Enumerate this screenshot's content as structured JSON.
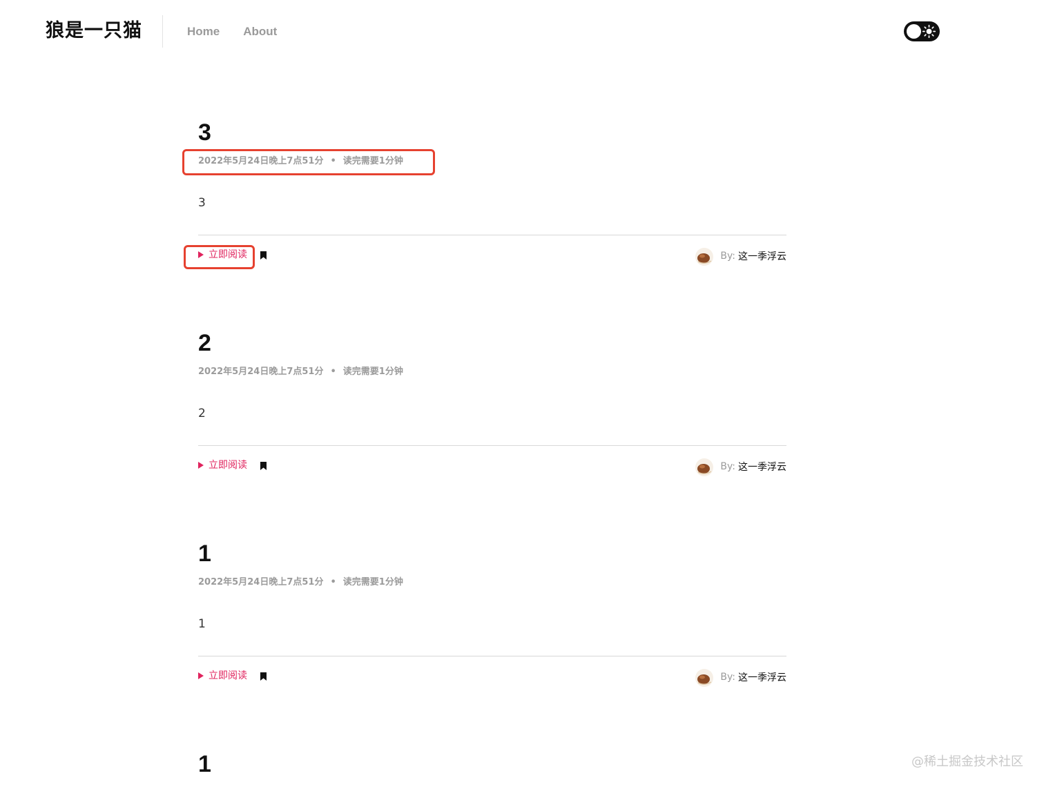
{
  "header": {
    "site_title": "狼是一只猫",
    "nav": [
      {
        "label": "Home"
      },
      {
        "label": "About"
      }
    ]
  },
  "posts": [
    {
      "title": "3",
      "date": "2022年5月24日晚上7点51分",
      "read_time": "读完需要1分钟",
      "excerpt": "3",
      "read_label": "立即阅读",
      "by_label": "By:",
      "author": "这一季浮云"
    },
    {
      "title": "2",
      "date": "2022年5月24日晚上7点51分",
      "read_time": "读完需要1分钟",
      "excerpt": "2",
      "read_label": "立即阅读",
      "by_label": "By:",
      "author": "这一季浮云"
    },
    {
      "title": "1",
      "date": "2022年5月24日晚上7点51分",
      "read_time": "读完需要1分钟",
      "excerpt": "1",
      "read_label": "立即阅读",
      "by_label": "By:",
      "author": "这一季浮云"
    },
    {
      "title": "1"
    }
  ],
  "watermark": "@稀土掘金技术社区",
  "colors": {
    "accent": "#e0245e",
    "meta": "#9b9b9b",
    "highlight": "#e6412f",
    "toggle": "#111111"
  },
  "icons": {
    "toggle": "theme-toggle-sun-icon",
    "read": "play-triangle-icon",
    "bookmark": "bookmark-icon",
    "avatar": "avatar-image"
  }
}
